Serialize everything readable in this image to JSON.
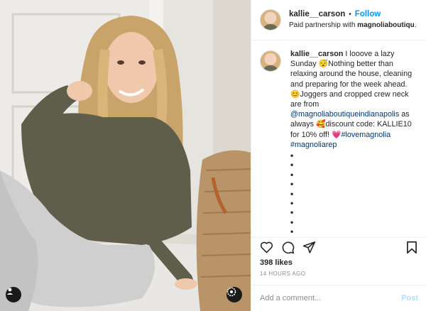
{
  "photo": {
    "alt_people_icon": "person-tag-icon",
    "badge_icon": "brand-badge-icon"
  },
  "header": {
    "username": "kallie__carson",
    "separator": "•",
    "follow_label": "Follow",
    "paid_prefix": "Paid partnership with ",
    "paid_partner": "magnoliaboutiquein..."
  },
  "caption": {
    "username": "kallie__carson",
    "text_1": " I looove a lazy Sunday ",
    "emoji_1": "😴",
    "text_2": "Nothing better than relaxing around the house, cleaning and preparing for the week ahead. ",
    "emoji_2": "😊",
    "text_3": "Joggers and cropped crew neck are from ",
    "mention": "@magnoliaboutiqueindianapolis",
    "text_4": " as always ",
    "emoji_3": "🥰",
    "text_5": "discount code: KALLIE10 for 10% off! ",
    "emoji_4": "💗",
    "hashtag_1": "#lovemagnolia",
    "hashtag_2": "#magnoliarep",
    "dots": [
      "•",
      "•",
      "•",
      "•",
      "•",
      "•",
      "•",
      "•",
      "•",
      "•",
      "•"
    ]
  },
  "actions": {
    "like_icon": "heart-icon",
    "comment_icon": "comment-icon",
    "share_icon": "share-icon",
    "save_icon": "bookmark-icon"
  },
  "likes": "398 likes",
  "timestamp": "14 HOURS AGO",
  "comment": {
    "placeholder": "Add a comment...",
    "post_label": "Post"
  },
  "colors": {
    "accent_blue": "#0095f6",
    "post_disabled": "#b2dffc",
    "link": "#00376b",
    "muted": "#8e8e8e"
  }
}
